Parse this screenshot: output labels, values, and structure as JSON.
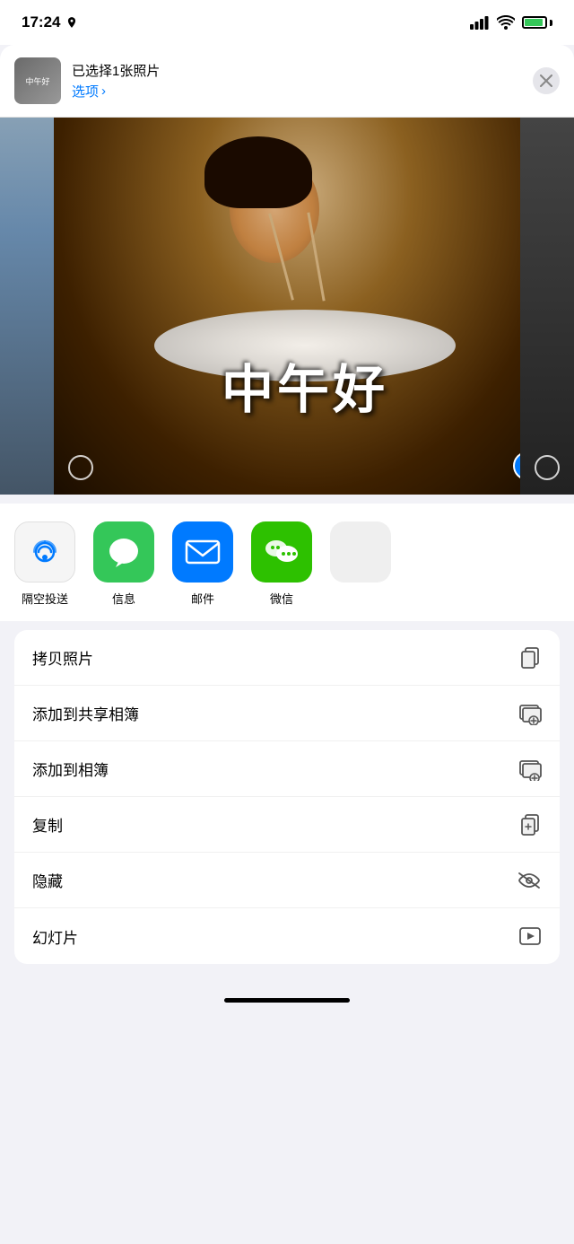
{
  "statusBar": {
    "time": "17:24",
    "locationArrow": "➤"
  },
  "header": {
    "title": "已选择1张照片",
    "subtitle": "选项",
    "subtitleArrow": "›",
    "closeLabel": "×"
  },
  "photoStrip": {
    "memeText": "中午好",
    "altText": "中午好 meme"
  },
  "apps": [
    {
      "id": "airdrop",
      "label": "隔空投送",
      "color": "#f0f0f0"
    },
    {
      "id": "messages",
      "label": "信息",
      "color": "#34c759"
    },
    {
      "id": "mail",
      "label": "邮件",
      "color": "#007aff"
    },
    {
      "id": "wechat",
      "label": "微信",
      "color": "#2dc100"
    }
  ],
  "actions": [
    {
      "id": "copy-photo",
      "label": "拷贝照片",
      "icon": "copy"
    },
    {
      "id": "add-shared-album",
      "label": "添加到共享相簿",
      "icon": "shared-album"
    },
    {
      "id": "add-album",
      "label": "添加到相簿",
      "icon": "add-album"
    },
    {
      "id": "duplicate",
      "label": "复制",
      "icon": "duplicate"
    },
    {
      "id": "hide",
      "label": "隐藏",
      "icon": "hide"
    },
    {
      "id": "slideshow",
      "label": "幻灯片",
      "icon": "slideshow"
    }
  ]
}
